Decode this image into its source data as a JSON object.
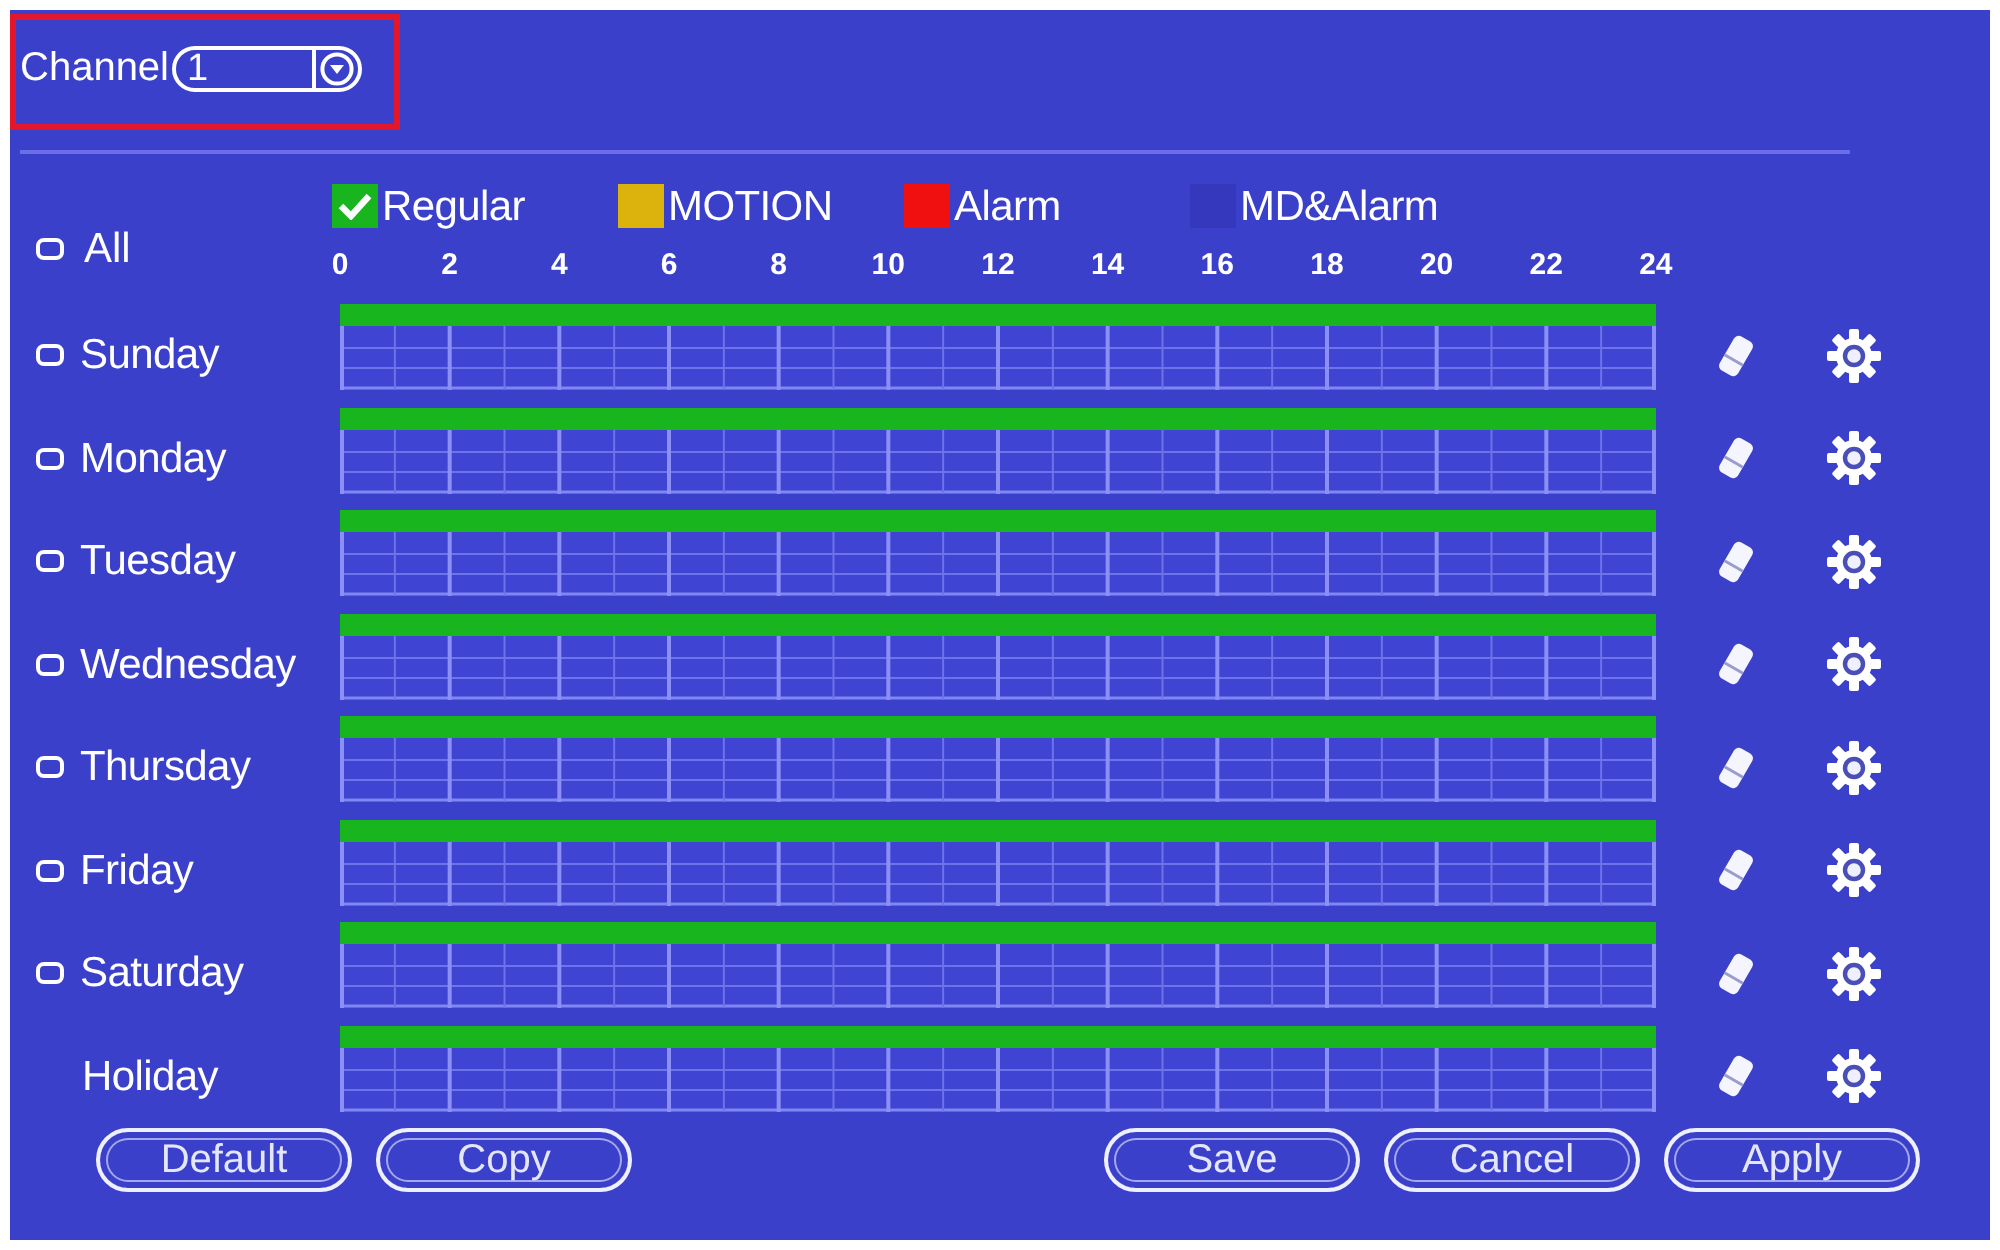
{
  "channel": {
    "label": "Channel",
    "value": "1",
    "highlighted": true
  },
  "legend": [
    {
      "label": "Regular",
      "color": "#19b51f",
      "checked": true
    },
    {
      "label": "MOTION",
      "color": "#dcb20c",
      "checked": false
    },
    {
      "label": "Alarm",
      "color": "#f01010",
      "checked": false
    },
    {
      "label": "MD&Alarm",
      "color": "#3538bd",
      "checked": false
    }
  ],
  "all": {
    "label": "All",
    "checked": false
  },
  "hours": [
    "0",
    "2",
    "4",
    "6",
    "8",
    "10",
    "12",
    "14",
    "16",
    "18",
    "20",
    "22",
    "24"
  ],
  "days": [
    {
      "label": "Sunday",
      "checked": false,
      "level": 1
    },
    {
      "label": "Monday",
      "checked": false,
      "level": 1
    },
    {
      "label": "Tuesday",
      "checked": false,
      "level": 1
    },
    {
      "label": "Wednesday",
      "checked": false,
      "level": 1
    },
    {
      "label": "Thursday",
      "checked": false,
      "level": 1
    },
    {
      "label": "Friday",
      "checked": false,
      "level": 1
    },
    {
      "label": "Saturday",
      "checked": false,
      "level": 1
    }
  ],
  "holiday": {
    "label": "Holiday",
    "level": 1
  },
  "buttons_left": [
    "Default",
    "Copy"
  ],
  "buttons_right": [
    "Save",
    "Cancel",
    "Apply"
  ]
}
